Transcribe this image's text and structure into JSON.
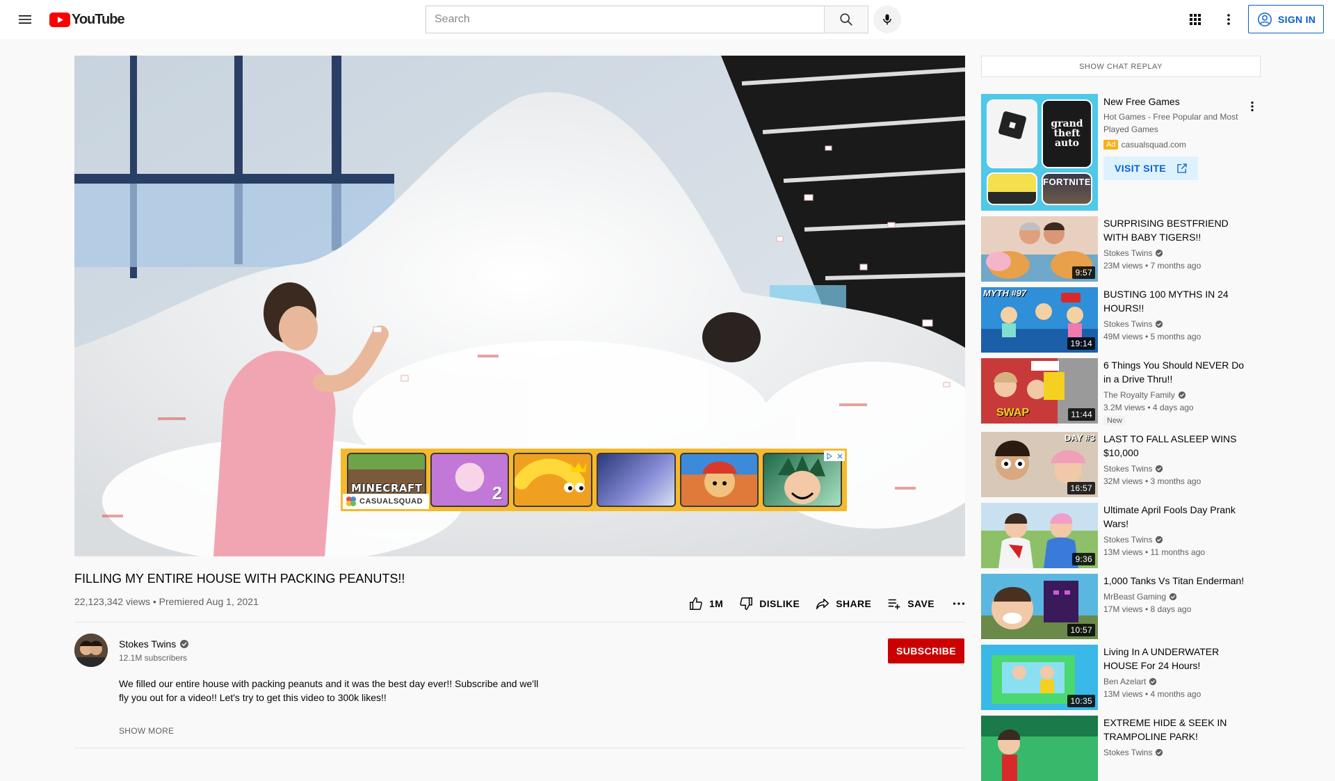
{
  "masthead": {
    "logo_text": "YouTube",
    "search_placeholder": "Search",
    "signin_label": "SIGN IN"
  },
  "player": {
    "ad_tiles": [
      "MINECRAFT",
      "",
      "",
      "",
      "",
      ""
    ],
    "ad_brand": "CASUALSQUAD",
    "ad_tile_badge": "2"
  },
  "video": {
    "title": "FILLING MY ENTIRE HOUSE WITH PACKING PEANUTS!!",
    "meta": "22,123,342 views • Premiered Aug 1, 2021",
    "like_count": "1M",
    "dislike_label": "DISLIKE",
    "share_label": "SHARE",
    "save_label": "SAVE"
  },
  "owner": {
    "name": "Stokes Twins",
    "subscribers": "12.1M subscribers",
    "subscribe_label": "SUBSCRIBE"
  },
  "description": {
    "text": "We filled our entire house with packing peanuts and it was the best day ever!! Subscribe and we'll fly you out for a video!! Let's try to get this video to 300k likes!!",
    "show_more": "SHOW MORE"
  },
  "secondary": {
    "chat_replay": "SHOW CHAT REPLAY",
    "ad": {
      "title": "New Free Games",
      "description": "Hot Games - Free Popular and Most Played Games",
      "badge": "Ad",
      "domain": "casualsquad.com",
      "visit_label": "VISIT SITE",
      "thumb_labels": [
        "grand theft auto",
        "FORTNITE"
      ]
    },
    "recommendations": [
      {
        "title": "SURPRISING BESTFRIEND WITH BABY TIGERS!!",
        "channel": "Stokes Twins",
        "meta": "23M views • 7 months ago",
        "duration": "9:57",
        "badge": "",
        "thumb_text": ""
      },
      {
        "title": "BUSTING 100 MYTHS IN 24 HOURS!!",
        "channel": "Stokes Twins",
        "meta": "49M views • 5 months ago",
        "duration": "19:14",
        "badge": "",
        "thumb_text": "MYTH #97"
      },
      {
        "title": "6 Things You Should NEVER Do in a Drive Thru!!",
        "channel": "The Royalty Family",
        "meta": "3.2M views • 4 days ago",
        "duration": "11:44",
        "badge": "New",
        "thumb_text": "SWAP"
      },
      {
        "title": "LAST TO FALL ASLEEP WINS $10,000",
        "channel": "Stokes Twins",
        "meta": "32M views • 3 months ago",
        "duration": "16:57",
        "badge": "",
        "thumb_text": "DAY #3"
      },
      {
        "title": "Ultimate April Fools Day Prank Wars!",
        "channel": "Stokes Twins",
        "meta": "13M views • 11 months ago",
        "duration": "9:36",
        "badge": "",
        "thumb_text": ""
      },
      {
        "title": "1,000 Tanks Vs Titan Enderman!",
        "channel": "MrBeast Gaming",
        "meta": "17M views • 8 days ago",
        "duration": "10:57",
        "badge": "",
        "thumb_text": ""
      },
      {
        "title": "Living In A UNDERWATER HOUSE For 24 Hours!",
        "channel": "Ben Azelart",
        "meta": "13M views • 4 months ago",
        "duration": "10:35",
        "badge": "",
        "thumb_text": ""
      },
      {
        "title": "EXTREME HIDE & SEEK IN TRAMPOLINE PARK!",
        "channel": "Stokes Twins",
        "meta": "",
        "duration": "",
        "badge": "",
        "thumb_text": ""
      }
    ]
  },
  "colors": {
    "brand_red": "#ff0000",
    "subscribe_red": "#cc0000",
    "link_blue": "#065fd4",
    "ad_yellow": "#f6b92b"
  }
}
